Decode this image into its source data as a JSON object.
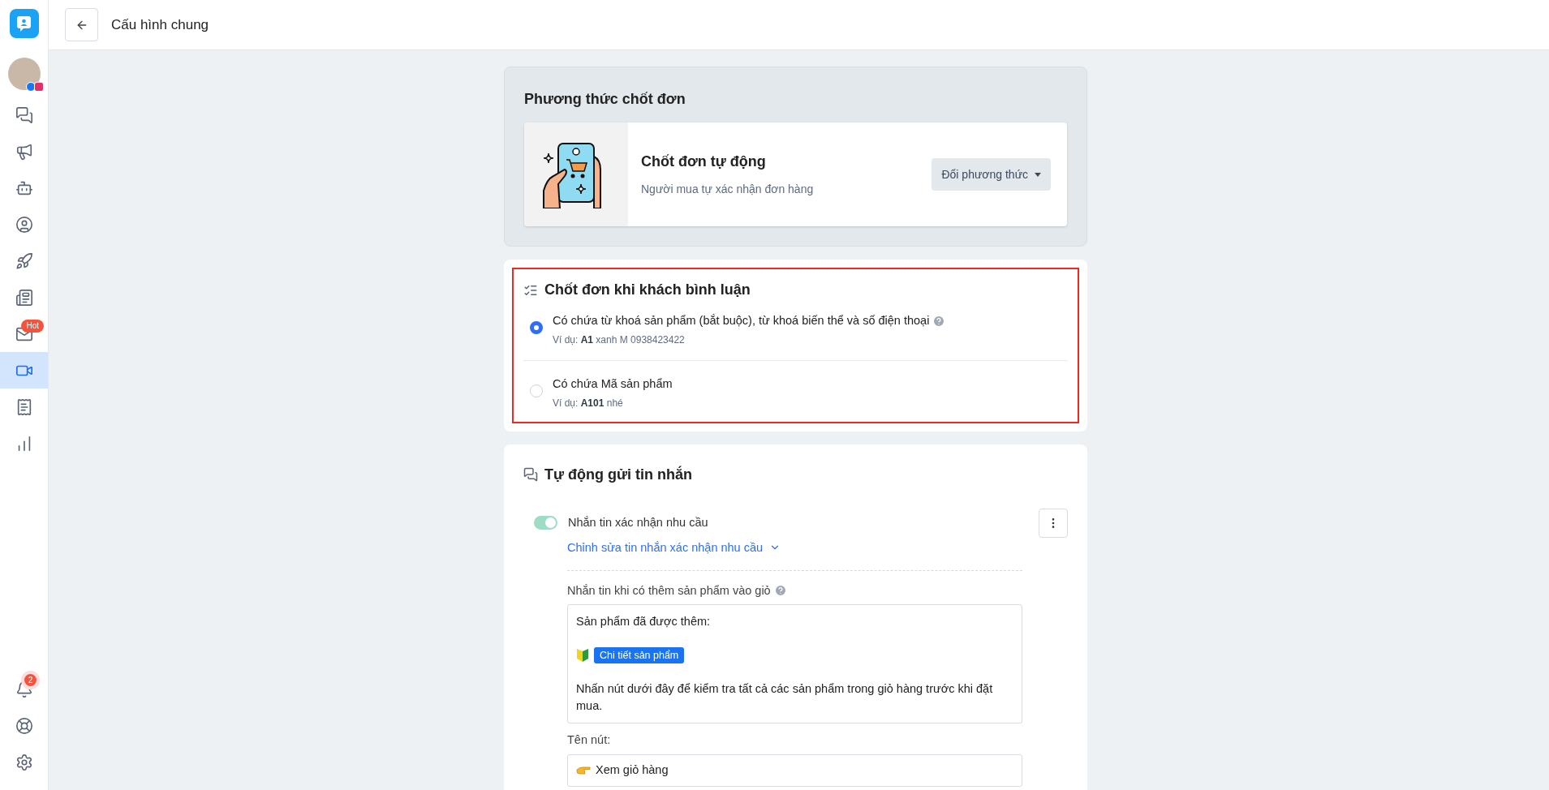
{
  "header": {
    "title": "Cấu hình chung"
  },
  "sidebar": {
    "items": [
      {
        "kind": "chat",
        "selected": false
      },
      {
        "kind": "megaphone",
        "selected": false
      },
      {
        "kind": "bot",
        "selected": false
      },
      {
        "kind": "user",
        "selected": false
      },
      {
        "kind": "rocket",
        "selected": false
      },
      {
        "kind": "news",
        "selected": false
      },
      {
        "kind": "mail",
        "selected": false,
        "badge": "Hot"
      },
      {
        "kind": "live",
        "selected": true
      },
      {
        "kind": "invoice",
        "selected": false
      },
      {
        "kind": "chart",
        "selected": false
      }
    ],
    "bottom": [
      {
        "kind": "bell",
        "badge": "2"
      },
      {
        "kind": "help"
      },
      {
        "kind": "settings"
      }
    ]
  },
  "method": {
    "title": "Phương thức chốt đơn",
    "name": "Chốt đơn tự động",
    "description": "Người mua tự xác nhận đơn hàng",
    "button": "Đổi phương thức"
  },
  "comment_rule": {
    "title": "Chốt đơn khi khách bình luận",
    "highlighted": true,
    "options": [
      {
        "label": "Có chứa từ khoá sản phẩm (bắt buộc), từ khoá biến thể và số điện thoại",
        "help": true,
        "example": "Ví dụ: **A1** xanh M 0938423422",
        "selected": true
      },
      {
        "label": "Có chứa Mã sản phẩm",
        "help": false,
        "example": "Ví dụ: **A101** nhé",
        "selected": false
      }
    ]
  },
  "auto_message": {
    "title": "Tự động gửi tin nhắn",
    "toggle": {
      "label": "Nhắn tin xác nhận nhu cầu",
      "on": true
    },
    "edit_link": "Chỉnh sửa tin nhắn xác nhận nhu cầu",
    "cart_message": {
      "label": "Nhắn tin khi có thêm sản phẩm vào giỏ",
      "first_line": "Sản phẩm đã được thêm:",
      "chip": "Chi tiết sản phẩm",
      "last_line": "Nhấn nút dưới đây để kiểm tra tất cả các sản phẩm trong giỏ hàng trước khi đặt mua."
    },
    "button_name": {
      "label": "Tên nút:",
      "value": "Xem giỏ hàng"
    }
  }
}
